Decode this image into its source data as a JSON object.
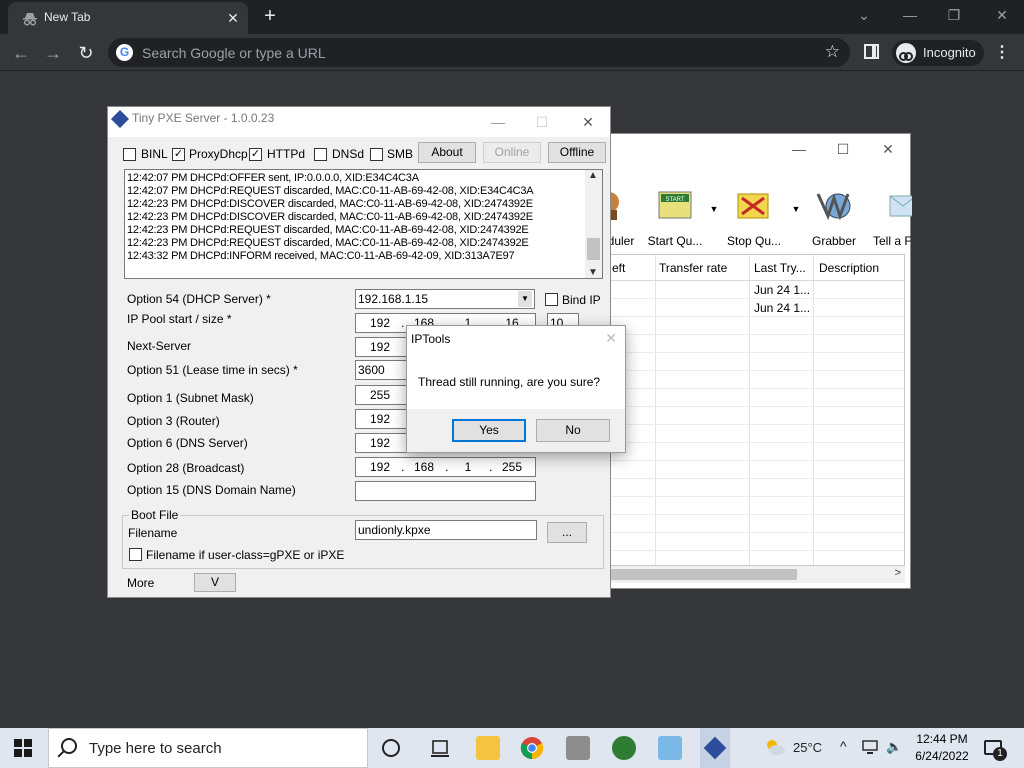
{
  "browser": {
    "tab_title": "New Tab",
    "omnibox_placeholder": "Search Google or type a URL",
    "incognito_label": "Incognito"
  },
  "download_window": {
    "toolbar": [
      {
        "label": "duler",
        "icon": "scheduler-icon"
      },
      {
        "label": "Start Qu...",
        "icon": "start-queue-icon"
      },
      {
        "label": "Stop Qu...",
        "icon": "stop-queue-icon"
      },
      {
        "label": "Grabber",
        "icon": "grabber-icon"
      },
      {
        "label": "Tell a Fr",
        "icon": "tell-friend-icon"
      }
    ],
    "columns": [
      "eft",
      "Transfer rate",
      "Last Try...",
      "Description"
    ],
    "rows": [
      {
        "last_try": "Jun 24 1..."
      },
      {
        "last_try": "Jun 24 1..."
      }
    ]
  },
  "pxe": {
    "title": "Tiny PXE Server - 1.0.0.23",
    "checkboxes": [
      {
        "label": "BINL",
        "checked": false
      },
      {
        "label": "ProxyDhcp",
        "checked": true
      },
      {
        "label": "HTTPd",
        "checked": true
      },
      {
        "label": "DNSd",
        "checked": false
      },
      {
        "label": "SMB",
        "checked": false
      }
    ],
    "buttons": {
      "about": "About",
      "online": "Online",
      "offline": "Offline"
    },
    "log": [
      "12:42:07 PM DHCPd:OFFER sent, IP:0.0.0.0, XID:E34C4C3A",
      "12:42:07 PM DHCPd:REQUEST discarded, MAC:C0-11-AB-69-42-08, XID:E34C4C3A",
      "12:42:23 PM DHCPd:DISCOVER discarded, MAC:C0-11-AB-69-42-08, XID:2474392E",
      "12:42:23 PM DHCPd:DISCOVER discarded, MAC:C0-11-AB-69-42-08, XID:2474392E",
      "12:42:23 PM DHCPd:REQUEST discarded, MAC:C0-11-AB-69-42-08, XID:2474392E",
      "12:42:23 PM DHCPd:REQUEST discarded, MAC:C0-11-AB-69-42-08, XID:2474392E",
      "12:43:32 PM DHCPd:INFORM received, MAC:C0-11-AB-69-42-09, XID:313A7E97"
    ],
    "labels": {
      "opt54": "Option 54 (DHCP Server) *",
      "pool": "IP Pool start / size *",
      "next_server": "Next-Server",
      "opt51": "Option 51 (Lease time in secs) *",
      "opt1": "Option 1  (Subnet Mask)",
      "opt3": "Option 3  (Router)",
      "opt6": "Option 6  (DNS Server)",
      "opt28": "Option 28 (Broadcast)",
      "opt15": "Option 15 (DNS Domain Name)",
      "bind_ip": "Bind IP",
      "boot_file": "Boot File",
      "filename": "Filename",
      "filename_userclass": "Filename if user-class=gPXE or iPXE",
      "more": "More"
    },
    "values": {
      "opt54": "192.168.1.15",
      "pool": [
        "192",
        "168",
        "1",
        "16"
      ],
      "pool_size": "10",
      "next_server": [
        "192"
      ],
      "opt51": "3600",
      "opt1": [
        "255"
      ],
      "opt3": [
        "192"
      ],
      "opt6": [
        "192"
      ],
      "opt28": [
        "192",
        "168",
        "1",
        "255"
      ],
      "opt15": "",
      "filename": "undionly.kpxe",
      "browse": "...",
      "more_btn": "V"
    }
  },
  "dialog": {
    "title": "IPTools",
    "message": "Thread still running, are you sure?",
    "yes": "Yes",
    "no": "No"
  },
  "taskbar": {
    "search_placeholder": "Type here to search",
    "temperature": "25°C",
    "time": "12:44 PM",
    "date": "6/24/2022",
    "notification_count": "1"
  }
}
